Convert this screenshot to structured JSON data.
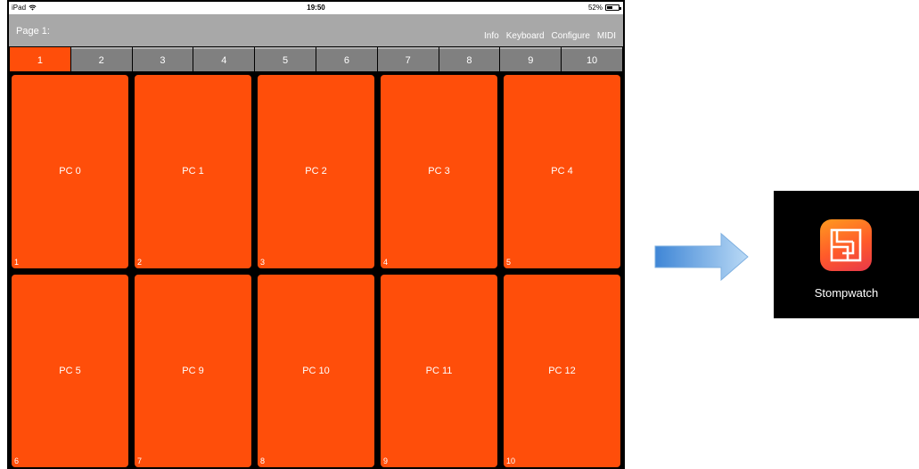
{
  "status_bar": {
    "device": "iPad",
    "time": "19:50",
    "battery": "52%",
    "battery_level": 0.52
  },
  "header": {
    "title": "Page 1:",
    "menu": [
      "Info",
      "Keyboard",
      "Configure",
      "MIDI"
    ]
  },
  "tabs": [
    "1",
    "2",
    "3",
    "4",
    "5",
    "6",
    "7",
    "8",
    "9",
    "10"
  ],
  "active_tab": 0,
  "pads": [
    {
      "label": "PC 0",
      "number": "1"
    },
    {
      "label": "PC 1",
      "number": "2"
    },
    {
      "label": "PC 2",
      "number": "3"
    },
    {
      "label": "PC 3",
      "number": "4"
    },
    {
      "label": "PC 4",
      "number": "5"
    },
    {
      "label": "PC 5",
      "number": "6"
    },
    {
      "label": "PC 9",
      "number": "7"
    },
    {
      "label": "PC 10",
      "number": "8"
    },
    {
      "label": "PC 11",
      "number": "9"
    },
    {
      "label": "PC 12",
      "number": "10"
    }
  ],
  "app": {
    "name": "Stompwatch",
    "icon": "stompwatch-logo-icon"
  },
  "arrow_icon": "right-arrow-icon",
  "colors": {
    "pad": "#ff4e0a",
    "tab_inactive": "#808080",
    "header": "#a8a8a8"
  }
}
